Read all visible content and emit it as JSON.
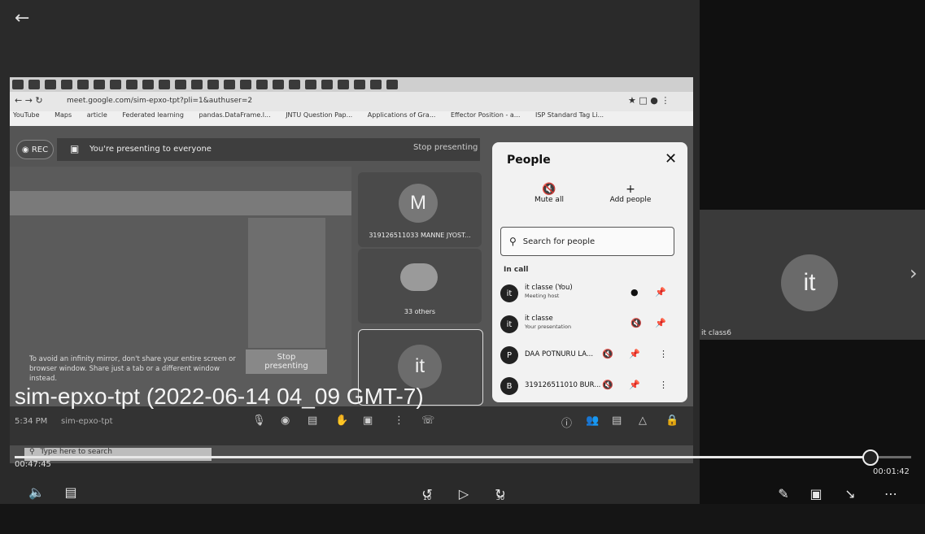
{
  "video_title": "sim-epxo-tpt (2022-06-14 04_09 GMT-7)",
  "player": {
    "elapsed": "00:47:45",
    "remaining": "00:01:42",
    "progress_fraction": 0.953,
    "rewind_label": "10",
    "forward_label": "30"
  },
  "browser": {
    "url": "meet.google.com/sim-epxo-tpt?pli=1&authuser=2",
    "bookmarks": [
      "YouTube",
      "Maps",
      "article",
      "Federated learning",
      "pandas.DataFrame.l...",
      "JNTU Question Pap...",
      "Applications of Gra...",
      "Effector Position - a...",
      "ISP Standard Tag Li..."
    ]
  },
  "meet": {
    "rec_label": "REC",
    "presenting_text": "You're presenting to everyone",
    "stop_presenting_top": "Stop presenting",
    "mirror_warning": "To avoid an infinity mirror, don't share your entire screen or browser window. Share just a tab or a different window instead.",
    "stop_button": "Stop presenting",
    "tile_m_initial": "M",
    "tile_m_name": "319126511033 MANNE JYOST...",
    "tile_others": "33 others",
    "tile_it_initial": "it",
    "time": "5:34 PM",
    "meeting_code": "sim-epxo-tpt",
    "taskbar_search": "Type here to search"
  },
  "people_panel": {
    "title": "People",
    "mute_all": "Mute all",
    "add_people": "Add people",
    "search_placeholder": "Search for people",
    "in_call": "In call",
    "rows": [
      {
        "initial": "it",
        "name": "it classe (You)",
        "sub": "Meeting host"
      },
      {
        "initial": "it",
        "name": "it classe",
        "sub": "Your presentation"
      },
      {
        "initial": "P",
        "name": "DAA POTNURU LA...",
        "sub": ""
      },
      {
        "initial": "B",
        "name": "319126511010 BUR...",
        "sub": ""
      }
    ]
  },
  "right_tile": {
    "initial": "it",
    "name": "it class6"
  }
}
